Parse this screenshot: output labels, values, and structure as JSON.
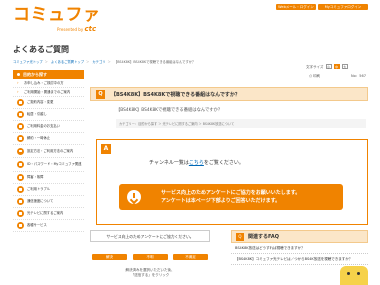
{
  "header": {
    "logo_main": "コミュファ",
    "logo_sub": "Presented by",
    "logo_brand": "ctc",
    "web_button": "Webメール・ログイン",
    "mycommufa_button": "Myコミュファログイン"
  },
  "page_title": "よくあるご質問",
  "breadcrumbs": [
    "コミュファ光トップ",
    "よくあるご質問トップ",
    "カテゴリ",
    "【BS4K8K】BS4K8Kで視聴できる番組はなんですか？"
  ],
  "font_size": {
    "label": "文字サイズ",
    "options": [
      "小",
      "中",
      "大"
    ],
    "selected": "中"
  },
  "sidebar": {
    "heading": "目的から探す",
    "items": [
      {
        "label": "お申し込み・ご検討中の方"
      },
      {
        "label": "ご利用開始・開通までのご案内"
      },
      {
        "label": "ご契約内容・変更"
      },
      {
        "label": "転居・引越し"
      },
      {
        "label": "ご利用料金のお支払い"
      },
      {
        "label": "解約・一時休止"
      },
      {
        "label": "設定方法・ご利用方法のご案内"
      },
      {
        "label": "ID・パスワード・Myコミュファ関連"
      },
      {
        "label": "障害・故障"
      },
      {
        "label": "ご利用トラブル"
      },
      {
        "label": "通信速度について"
      },
      {
        "label": "光テレビに関するご案内"
      },
      {
        "label": "各種サービス"
      }
    ]
  },
  "util": {
    "print": "印刷",
    "faq_no": "No：567"
  },
  "question": {
    "badge": "Q",
    "title": "【BS4K8K】BS4K8Kで視聴できる番組はなんですか？",
    "sub": "【BS4K8K】BS4K8Kで視聴できる番組はなんですか？",
    "meta": "カテゴリー：目的から探す ＞ 光テレビに関するご案内 ＞ BS4K8K放送について"
  },
  "answer": {
    "badge": "A",
    "text_before": "チャンネル一覧は",
    "link": "こちら",
    "text_after": "をご覧ください。"
  },
  "survey_banner": {
    "line1": "サービス向上のためアンケートにご協力をお願いいたします。",
    "line2": "アンケートは本ページ下部よりご回答いただけます。"
  },
  "survey": {
    "title": "サービス向上のためアンケートにご協力ください。",
    "buttons": [
      "解決",
      "不明",
      "不満足"
    ],
    "note_line1": "解決済みを選択いただいた後、",
    "note_line2": "「送信する」をクリック"
  },
  "related": {
    "badge": "Q",
    "heading": "関連するFAQ",
    "items": [
      "BS4K8K放送はどうすれば視聴できますか？",
      "【BS4K8K】コミュファ光テレビは／つからBS4K放送を視聴できますか？"
    ]
  }
}
